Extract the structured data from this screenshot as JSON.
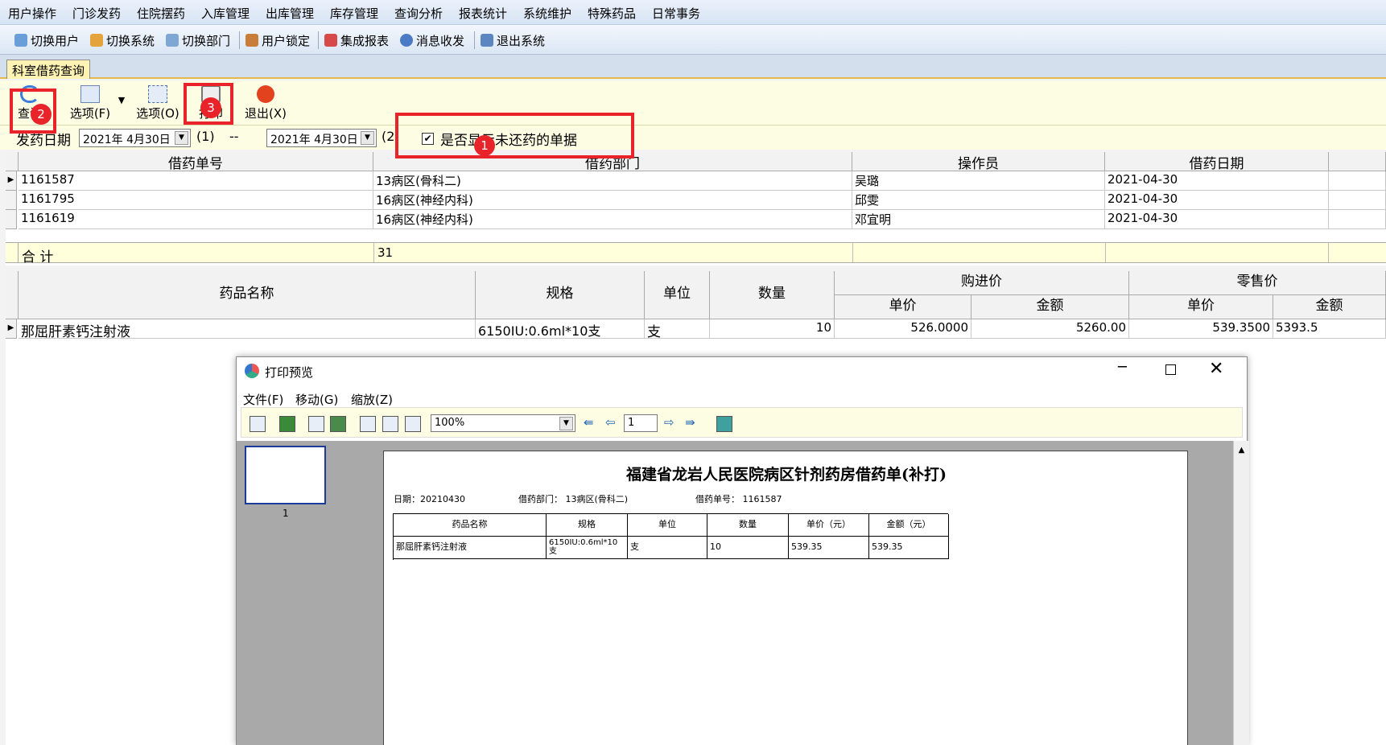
{
  "menu": [
    "用户操作",
    "门诊发药",
    "住院摆药",
    "入库管理",
    "出库管理",
    "库存管理",
    "查询分析",
    "报表统计",
    "系统维护",
    "特殊药品",
    "日常事务"
  ],
  "toolbar": [
    "切换用户",
    "切换系统",
    "切换部门",
    "用户锁定",
    "集成报表",
    "消息收发",
    "退出系统"
  ],
  "tab": "科室借药查询",
  "actions": {
    "query": "查询",
    "opt1": "选项(F)",
    "opt2": "选项(O)",
    "print": "打印",
    "exit": "退出(X)"
  },
  "filter": {
    "label": "发药日期",
    "from": "2021年 4月30日",
    "from_key": "(1)",
    "dash": "--",
    "to": "2021年 4月30日",
    "to_key": "(2",
    "checkbox_label": "是否显示未还药的单据",
    "checked": true
  },
  "grid1": {
    "headers": [
      "借药单号",
      "借药部门",
      "操作员",
      "借药日期"
    ],
    "rows": [
      [
        "1161587",
        "13病区(骨科二)",
        "吴璐",
        "2021-04-30"
      ],
      [
        "1161795",
        "16病区(神经内科)",
        "邱雯",
        "2021-04-30"
      ],
      [
        "1161619",
        "16病区(神经内科)",
        "邓宜明",
        "2021-04-30"
      ]
    ],
    "total_label": "合  计",
    "total_value": "31"
  },
  "grid2": {
    "headers": {
      "name": "药品名称",
      "spec": "规格",
      "unit": "单位",
      "qty": "数量",
      "purchase": "购进价",
      "retail": "零售价",
      "price": "单价",
      "amount": "金额"
    },
    "rows": [
      [
        "那屈肝素钙注射液",
        "6150IU:0.6ml*10支",
        "支",
        "10",
        "526.0000",
        "5260.00",
        "539.3500",
        "5393.5"
      ]
    ]
  },
  "annotations": {
    "b1": "1",
    "b2": "2",
    "b3": "3"
  },
  "preview": {
    "title": "打印预览",
    "menus": [
      "文件(F)",
      "移动(G)",
      "缩放(Z)"
    ],
    "zoom": "100%",
    "page": "1",
    "thumb_label": "1",
    "doc_title": "福建省龙岩人民医院病区针剂药房借药单(补打)",
    "meta": {
      "date": "日期：20210430",
      "dept": "借药部门：  13病区(骨科二)",
      "no": "借药单号：  1161587"
    },
    "table_headers": [
      "药品名称",
      "规格",
      "单位",
      "数量",
      "单价（元）",
      "金额（元）"
    ],
    "table_row": [
      "那屈肝素钙注射液",
      "6150IU:0.6ml*10支",
      "支",
      "10",
      "539.35",
      "539.35"
    ]
  },
  "colors": {
    "accent_red": "#e8232a",
    "yellow_bg": "#fdfde4"
  }
}
